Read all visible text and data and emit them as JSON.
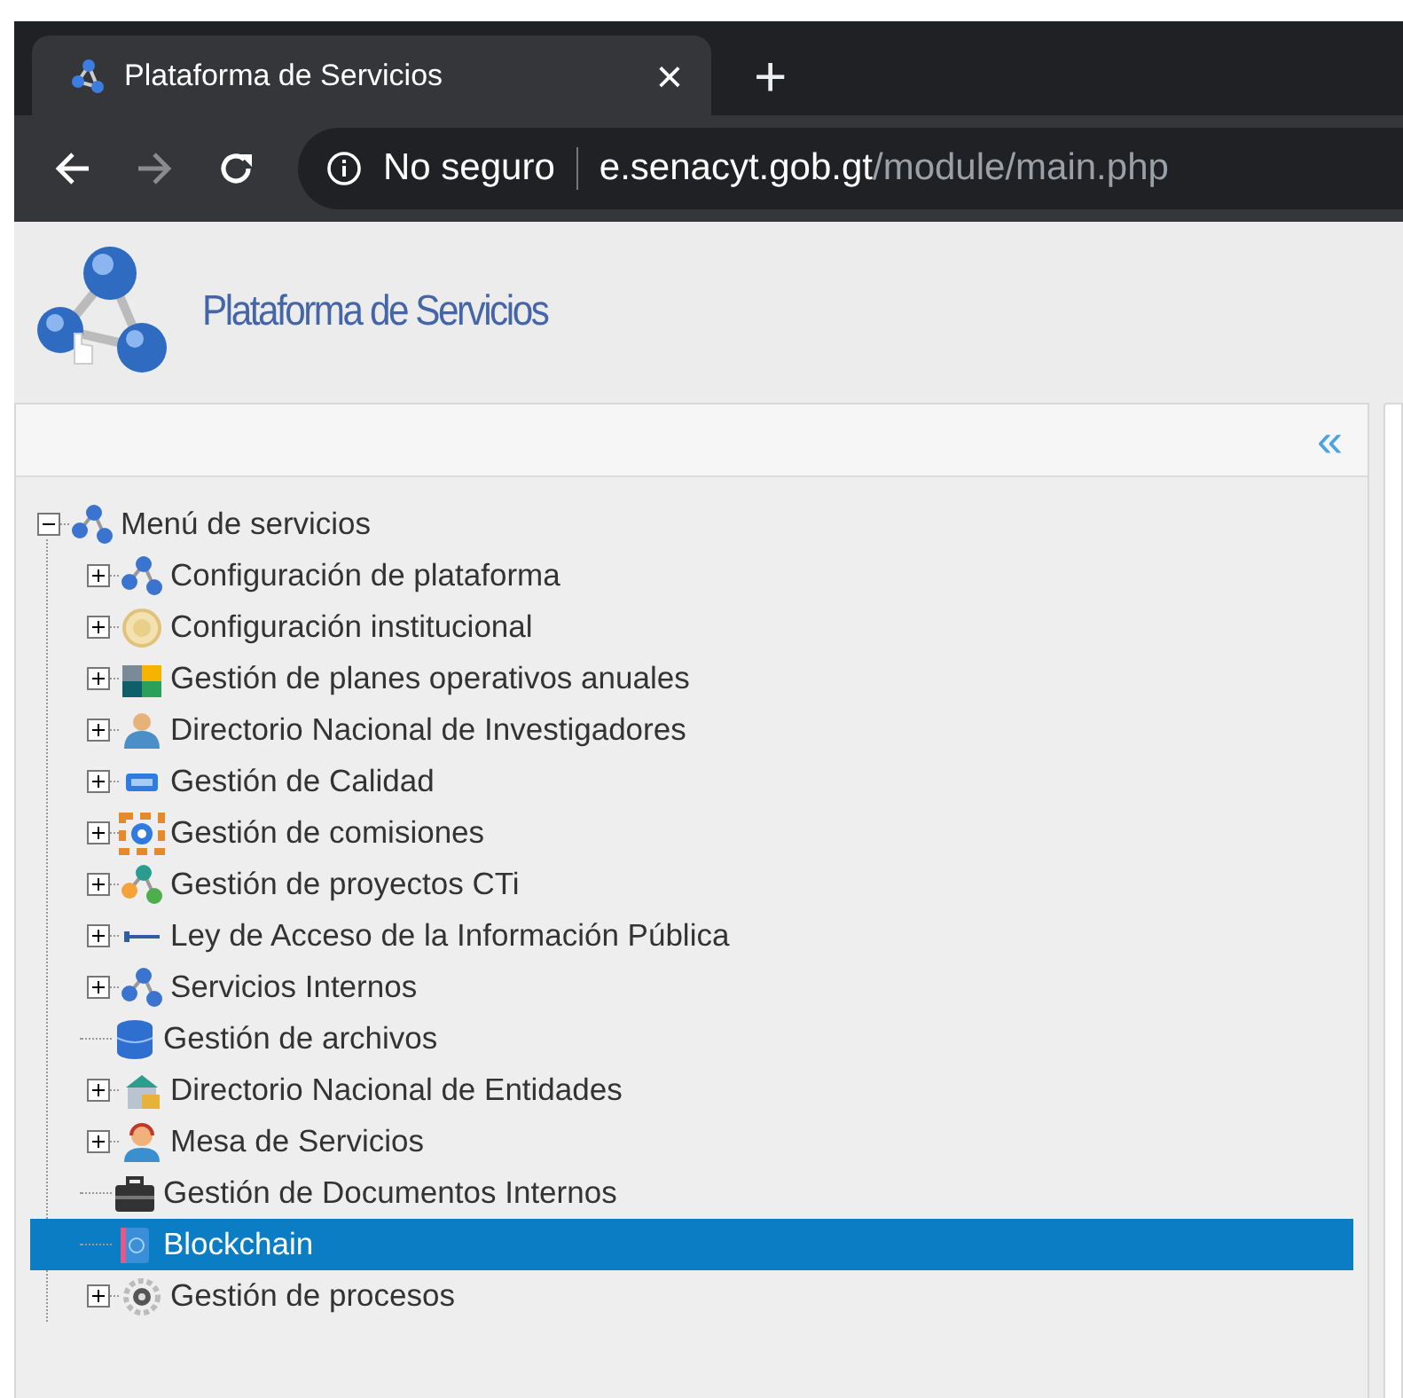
{
  "browser": {
    "tab": {
      "title": "Plataforma de Servicios",
      "close": "×",
      "selected": true
    },
    "new_tab": "+",
    "address": {
      "security": "No seguro",
      "host": "e.senacyt.gob.gt",
      "path": "/module/main.php"
    }
  },
  "header": {
    "title": "Plataforma de Servicios"
  },
  "panel": {
    "collapse": "«"
  },
  "tree": {
    "label": "Menú de servicios",
    "kind": "branch",
    "expanded": true,
    "selected": false,
    "children": [
      {
        "label": "Configuración de plataforma",
        "kind": "branch",
        "expanded": false,
        "selected": false
      },
      {
        "label": "Configuración institucional",
        "kind": "branch",
        "expanded": false,
        "selected": false
      },
      {
        "label": "Gestión de planes operativos anuales",
        "kind": "branch",
        "expanded": false,
        "selected": false
      },
      {
        "label": "Directorio Nacional de Investigadores",
        "kind": "branch",
        "expanded": false,
        "selected": false
      },
      {
        "label": "Gestión de Calidad",
        "kind": "branch",
        "expanded": false,
        "selected": false
      },
      {
        "label": "Gestión de comisiones",
        "kind": "branch",
        "expanded": false,
        "selected": false
      },
      {
        "label": "Gestión de proyectos CTi",
        "kind": "branch",
        "expanded": false,
        "selected": false
      },
      {
        "label": "Ley de Acceso de la Información Pública",
        "kind": "branch",
        "expanded": false,
        "selected": false
      },
      {
        "label": "Servicios Internos",
        "kind": "branch",
        "expanded": false,
        "selected": false
      },
      {
        "label": "Gestión de archivos",
        "kind": "leaf",
        "selected": false
      },
      {
        "label": "Directorio Nacional de Entidades",
        "kind": "branch",
        "expanded": false,
        "selected": false
      },
      {
        "label": "Mesa de Servicios",
        "kind": "branch",
        "expanded": false,
        "selected": false
      },
      {
        "label": "Gestión de Documentos Internos",
        "kind": "leaf",
        "selected": false
      },
      {
        "label": "Blockchain",
        "kind": "leaf",
        "selected": true
      },
      {
        "label": "Gestión de procesos",
        "kind": "branch",
        "expanded": false,
        "selected": false
      }
    ]
  }
}
